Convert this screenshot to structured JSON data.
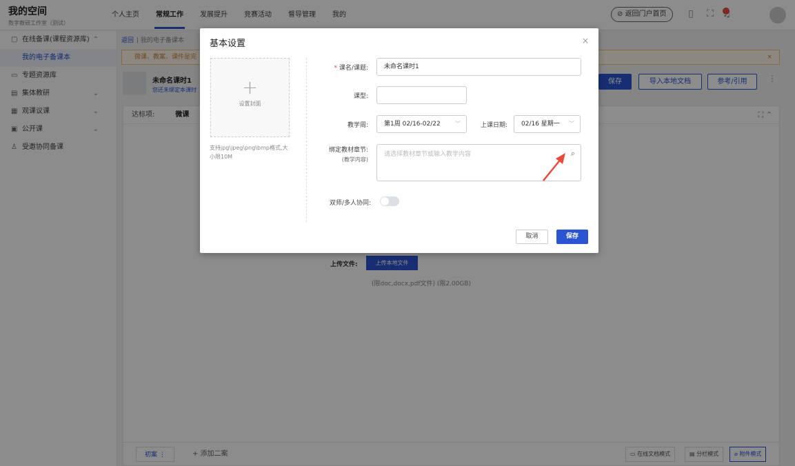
{
  "header": {
    "title": "我的空间",
    "subtitle": "数字教研工作室（测试）",
    "nav": [
      "个人主页",
      "常规工作",
      "发展提升",
      "竞赛活动",
      "督导管理",
      "我的"
    ],
    "active_nav": "常规工作",
    "portal_button": "返回门户首页",
    "icons": [
      "phone-icon",
      "fullscreen-icon",
      "bell-icon",
      "avatar-icon"
    ]
  },
  "sidebar": {
    "items": [
      {
        "label": "在线备课(课程资源库)",
        "icon": "book-icon",
        "expanded": true
      },
      {
        "label": "我的电子备课本",
        "sub": true
      },
      {
        "label": "专题资源库",
        "icon": "folder-icon"
      },
      {
        "label": "集体教研",
        "icon": "group-icon",
        "chevron": true
      },
      {
        "label": "观课议课",
        "icon": "observe-icon",
        "chevron": true
      },
      {
        "label": "公开课",
        "icon": "screen-icon",
        "chevron": true
      },
      {
        "label": "受邀协同备课",
        "icon": "people-icon"
      }
    ]
  },
  "main": {
    "breadcrumb_back": "返回",
    "breadcrumb_current": "我的电子备课本",
    "notice": "微课、教案、课件是完",
    "lesson_title": "未命名课时1",
    "lesson_sub": "您还未绑定本课时",
    "buttons": {
      "save": "保存",
      "import": "导入本地文档",
      "reference": "参考/引用"
    },
    "panel_label": "达标项:",
    "panel_type": "微课",
    "upload_label": "上传文件:",
    "upload_button": "上传本地文件",
    "upload_hint": "(限doc,docx,pdf文件)   (限2.00GB)",
    "draft_tab": "初案",
    "add_case": "+ 添加二案",
    "modes": [
      "在线文档模式",
      "分栏模式",
      "附件模式"
    ],
    "active_mode": "附件模式"
  },
  "modal": {
    "title": "基本设置",
    "cover_text": "设置封面",
    "cover_hint": "支持jpg\\jpeg\\png\\bmp格式,大小限10M",
    "fields": {
      "course_label": "课名/课题:",
      "course_value": "未命名课时1",
      "type_label": "课型:",
      "type_value": "",
      "week_label": "教学周:",
      "week_value": "第1周 02/16-02/22",
      "date_label": "上课日期:",
      "date_value": "02/16 星期一",
      "chapter_label": "绑定教材章节:",
      "chapter_sub": "(教学内容)",
      "chapter_placeholder": "请选择教材章节或输入教学内容",
      "coop_label": "双师/多人协同:"
    },
    "cancel": "取消",
    "save": "保存"
  },
  "colors": {
    "accent": "#2a54d1",
    "danger": "#e84a3c",
    "notice": "#f3c27a"
  }
}
